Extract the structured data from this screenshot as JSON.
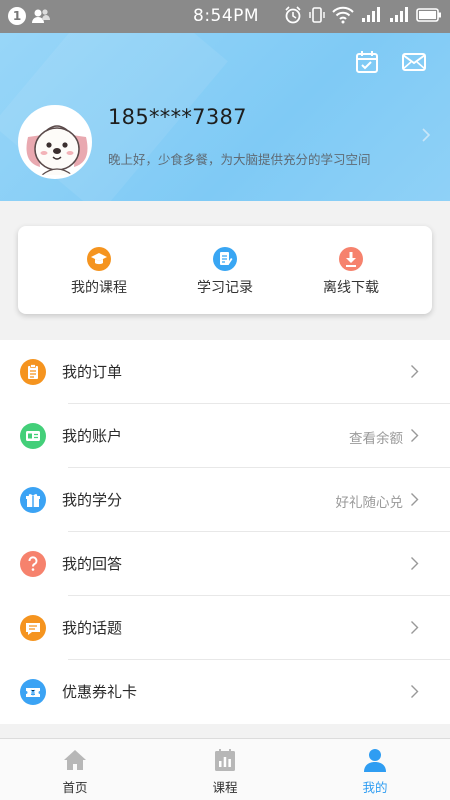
{
  "status_bar": {
    "notification_count": "1",
    "time": "8:54PM"
  },
  "header": {
    "phone": "185****7387",
    "greeting": "晚上好，少食多餐，为大脑提供充分的学习空间",
    "icons": [
      "calendar-check-icon",
      "mail-icon",
      "chevron-right-icon"
    ]
  },
  "quick_actions": [
    {
      "label": "我的课程",
      "icon": "graduation-cap-icon",
      "color": "#f5941f"
    },
    {
      "label": "学习记录",
      "icon": "document-edit-icon",
      "color": "#39a6f3"
    },
    {
      "label": "离线下载",
      "icon": "download-icon",
      "color": "#f6826d"
    }
  ],
  "menu": [
    {
      "label": "我的订单",
      "extra": "",
      "icon": "order-clipboard-icon",
      "color": "#f5941f"
    },
    {
      "label": "我的账户",
      "extra": "查看余额",
      "icon": "account-card-icon",
      "color": "#43cf79"
    },
    {
      "label": "我的学分",
      "extra": "好礼随心兑",
      "icon": "gift-icon",
      "color": "#3ba3f4"
    },
    {
      "label": "我的回答",
      "extra": "",
      "icon": "question-icon",
      "color": "#f6826d"
    },
    {
      "label": "我的话题",
      "extra": "",
      "icon": "chat-bubble-icon",
      "color": "#f5941f"
    },
    {
      "label": "优惠券礼卡",
      "extra": "",
      "icon": "coupon-icon",
      "color": "#3ba3f4"
    }
  ],
  "bottom_nav": [
    {
      "label": "首页",
      "icon": "home-icon",
      "active": false
    },
    {
      "label": "课程",
      "icon": "course-calendar-icon",
      "active": false
    },
    {
      "label": "我的",
      "icon": "profile-icon",
      "active": true
    }
  ],
  "colors": {
    "accent": "#2f9df2",
    "header_bg": "#8fd1f7",
    "status_bar_bg": "#8a8a8a"
  }
}
